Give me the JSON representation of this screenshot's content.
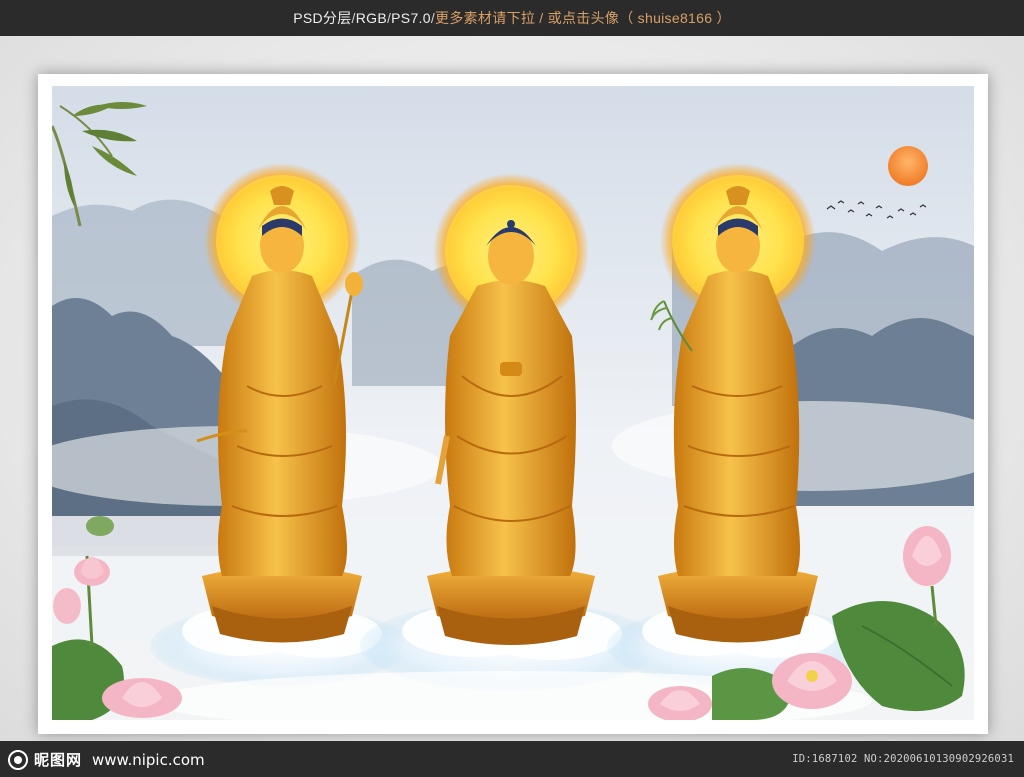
{
  "header": {
    "format": "PSD分层",
    "color_mode": "RGB",
    "version": "PS7.0",
    "promo": "更多素材请下拉 / 或点击头像",
    "author": "（ shuise8166 ）",
    "separator": " / "
  },
  "watermark": {
    "site_name": "昵图网",
    "url": "www.nipic.com",
    "id_line": "ID:1687102 NO:20200610130902926031"
  },
  "colors": {
    "sky": "#dfe6ee",
    "mountain": "#7d8ea3",
    "gold": "#e8a630",
    "halo": "#ffe14a",
    "sun": "#f28a2e",
    "lotus": "#f4b6c4",
    "leaf": "#4f8a3c"
  },
  "icons": {
    "logo": "nipic-logo-icon"
  }
}
